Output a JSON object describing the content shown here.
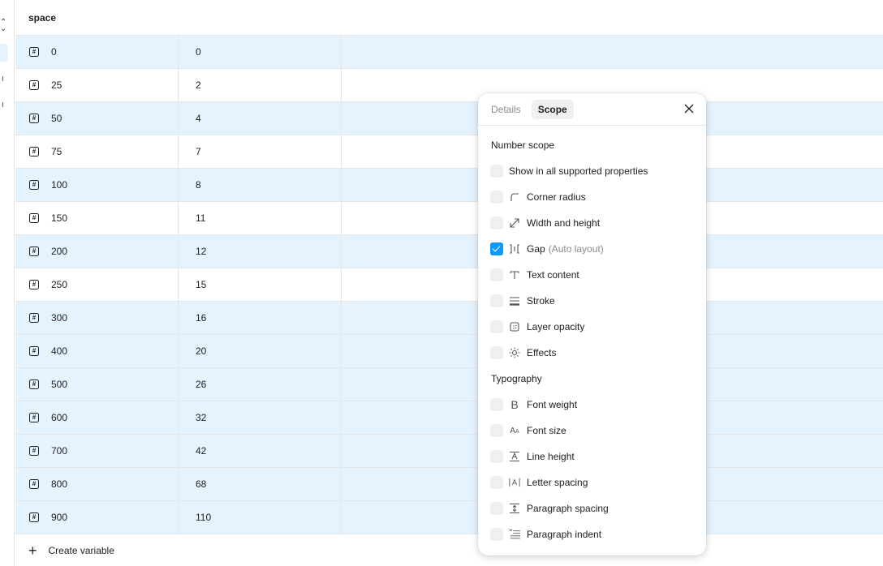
{
  "table": {
    "group_name": "space",
    "rows": [
      {
        "name": "0",
        "value": "0",
        "selected": true
      },
      {
        "name": "25",
        "value": "2",
        "selected": false
      },
      {
        "name": "50",
        "value": "4",
        "selected": true
      },
      {
        "name": "75",
        "value": "7",
        "selected": false
      },
      {
        "name": "100",
        "value": "8",
        "selected": true
      },
      {
        "name": "150",
        "value": "11",
        "selected": false
      },
      {
        "name": "200",
        "value": "12",
        "selected": true
      },
      {
        "name": "250",
        "value": "15",
        "selected": false
      },
      {
        "name": "300",
        "value": "16",
        "selected": true
      },
      {
        "name": "400",
        "value": "20",
        "selected": true
      },
      {
        "name": "500",
        "value": "26",
        "selected": true
      },
      {
        "name": "600",
        "value": "32",
        "selected": true
      },
      {
        "name": "700",
        "value": "42",
        "selected": true
      },
      {
        "name": "800",
        "value": "68",
        "selected": true
      },
      {
        "name": "900",
        "value": "110",
        "selected": true
      }
    ],
    "create_label": "Create variable"
  },
  "popover": {
    "tabs": [
      {
        "label": "Details",
        "active": false
      },
      {
        "label": "Scope",
        "active": true
      }
    ],
    "number_scope_heading": "Number scope",
    "show_all_label": "Show in all supported properties",
    "number_options": [
      {
        "label": "Corner radius",
        "hint": "",
        "checked": false,
        "icon": "corner-radius-icon"
      },
      {
        "label": "Width and height",
        "hint": "",
        "checked": false,
        "icon": "resize-icon"
      },
      {
        "label": "Gap",
        "hint": "(Auto layout)",
        "checked": true,
        "icon": "gap-icon"
      },
      {
        "label": "Text content",
        "hint": "",
        "checked": false,
        "icon": "text-icon"
      },
      {
        "label": "Stroke",
        "hint": "",
        "checked": false,
        "icon": "stroke-icon"
      },
      {
        "label": "Layer opacity",
        "hint": "",
        "checked": false,
        "icon": "opacity-icon"
      },
      {
        "label": "Effects",
        "hint": "",
        "checked": false,
        "icon": "effects-icon"
      }
    ],
    "typography_heading": "Typography",
    "typography_options": [
      {
        "label": "Font weight",
        "checked": false,
        "icon": "font-weight-icon"
      },
      {
        "label": "Font size",
        "checked": false,
        "icon": "font-size-icon"
      },
      {
        "label": "Line height",
        "checked": false,
        "icon": "line-height-icon"
      },
      {
        "label": "Letter spacing",
        "checked": false,
        "icon": "letter-spacing-icon"
      },
      {
        "label": "Paragraph spacing",
        "checked": false,
        "icon": "paragraph-spacing-icon"
      },
      {
        "label": "Paragraph indent",
        "checked": false,
        "icon": "paragraph-indent-icon"
      }
    ]
  },
  "colors": {
    "selected_row": "#e5f3ff",
    "checkbox_on": "#0d99ff"
  }
}
